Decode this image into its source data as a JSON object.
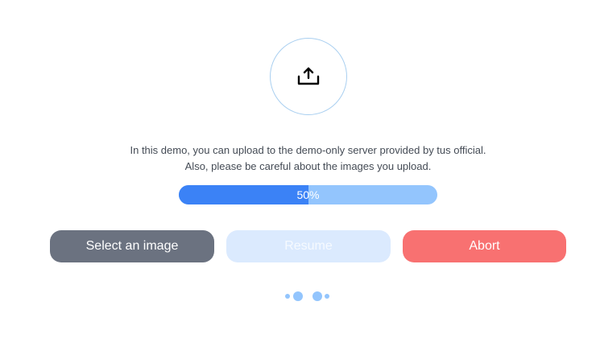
{
  "upload": {
    "icon": "upload-icon"
  },
  "description": {
    "line1": "In this demo, you can upload to the demo-only server provided by tus official.",
    "line2": "Also, please be careful about the images you upload."
  },
  "progress": {
    "value": 0.5,
    "label": "50%"
  },
  "buttons": {
    "select_label": "Select an image",
    "resume_label": "Resume",
    "abort_label": "Abort"
  },
  "loader": {
    "icon": "loading-dots-icon"
  },
  "colors": {
    "progress_fill": "#3b82f6",
    "progress_track": "#93c5fd",
    "select_button": "#6b7280",
    "resume_button": "#dbeafe",
    "abort_button": "#f87171"
  }
}
